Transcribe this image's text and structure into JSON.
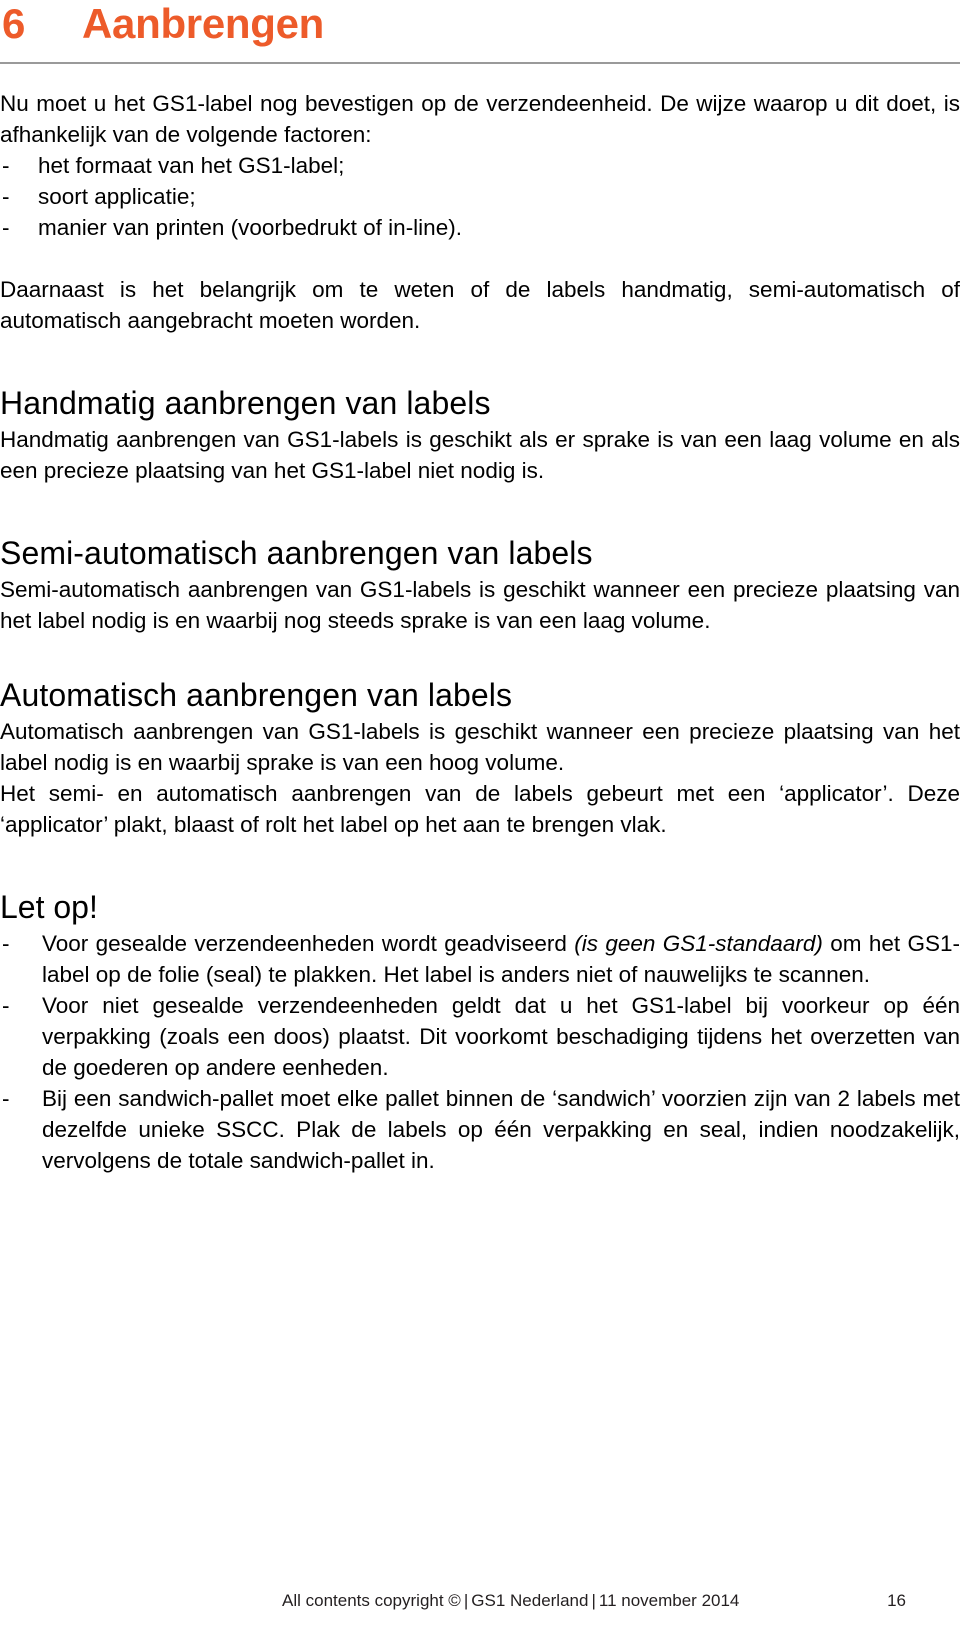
{
  "chapter": {
    "number": "6",
    "title": "Aanbrengen",
    "accent_color": "#ED5B2A"
  },
  "intro": {
    "lead": "Nu moet u het GS1-label nog bevestigen op de verzendeenheid. De wijze waarop u dit doet, is afhankelijk van de volgende factoren:",
    "dash": "-",
    "bullets": [
      "het formaat van het GS1-label;",
      "soort applicatie;",
      "manier van printen (voorbedrukt of in-line)."
    ],
    "paragraph": "Daarnaast is het belangrijk om te weten of de labels handmatig, semi-automatisch of automatisch aangebracht moeten worden."
  },
  "sections": [
    {
      "heading": "Handmatig aanbrengen van labels",
      "body": "Handmatig aanbrengen van GS1-labels is geschikt als er sprake is van een laag volume en als een precieze plaatsing van het GS1-label niet nodig is."
    },
    {
      "heading": "Semi-automatisch aanbrengen van labels",
      "body": "Semi-automatisch aanbrengen van GS1-labels is geschikt wanneer een precieze plaatsing van het label nodig is en waarbij nog steeds sprake is van een laag volume."
    },
    {
      "heading": "Automatisch aanbrengen van labels",
      "body": "Automatisch aanbrengen van GS1-labels is geschikt wanneer een precieze plaatsing van het label nodig is en waarbij sprake is van een hoog volume.",
      "body2": "Het semi- en automatisch aanbrengen van de labels gebeurt met een ‘applicator’. Deze ‘applicator’ plakt, blaast of rolt het label op het aan te brengen vlak."
    }
  ],
  "note": {
    "heading": "Let op!",
    "dash": "-",
    "items": [
      {
        "pre": "Voor gesealde verzendeenheden wordt geadviseerd ",
        "italic": "(is geen GS1-standaard)",
        "post": " om het GS1-label op de folie (seal) te plakken. Het label is anders niet of nauwelijks te scannen."
      },
      {
        "pre": "Voor niet gesealde verzendeenheden geldt dat u het GS1-label bij voorkeur op één verpakking (zoals een doos) plaatst. Dit voorkomt beschadiging tijdens het overzetten van de goederen op andere eenheden.",
        "italic": "",
        "post": ""
      },
      {
        "pre": "Bij een sandwich-pallet moet elke pallet binnen de ‘sandwich’ voorzien zijn van 2 labels met dezelfde unieke SSCC. Plak de labels op één verpakking en seal, indien noodzakelijk, vervolgens de totale sandwich-pallet in.",
        "italic": "",
        "post": ""
      }
    ]
  },
  "footer": {
    "copyright_prefix": "All contents copyright ©",
    "separator": "|",
    "organisation": "GS1 Nederland",
    "date": "11 november 2014",
    "page_number": "16"
  }
}
